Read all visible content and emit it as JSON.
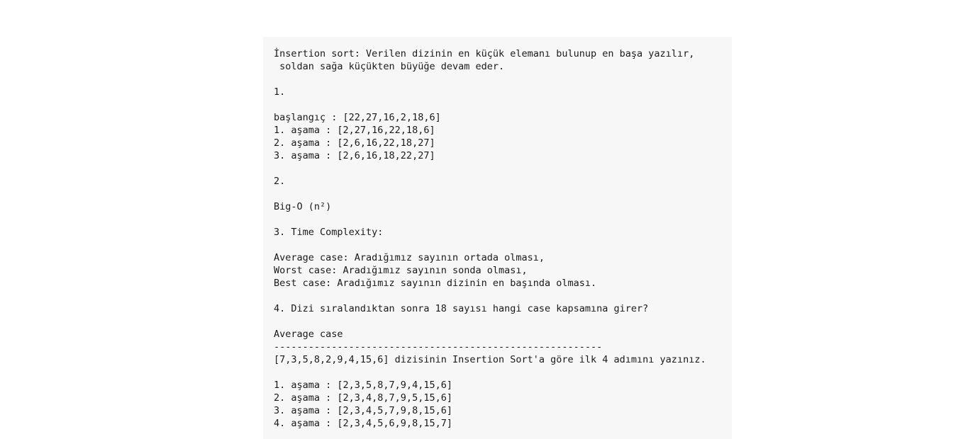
{
  "document": {
    "lines": [
      "İnsertion sort: Verilen dizinin en küçük elemanı bulunup en başa yazılır,",
      " soldan sağa küçükten büyüğe devam eder.",
      "",
      "1.",
      "",
      "başlangıç : [22,27,16,2,18,6]",
      "1. aşama : [2,27,16,22,18,6]",
      "2. aşama : [2,6,16,22,18,27]",
      "3. aşama : [2,6,16,18,22,27]",
      "",
      "2.",
      "",
      "Big-O (n²)",
      "",
      "3. Time Complexity:",
      "",
      "Average case: Aradığımız sayının ortada olması,",
      "Worst case: Aradığımız sayının sonda olması,",
      "Best case: Aradığımız sayının dizinin en başında olması.",
      "",
      "4. Dizi sıralandıktan sonra 18 sayısı hangi case kapsamına girer?",
      "",
      "Average case",
      "---------------------------------------------------------",
      "[7,3,5,8,2,9,4,15,6] dizisinin Insertion Sort'a göre ilk 4 adımını yazınız.",
      "",
      "1. aşama : [2,3,5,8,7,9,4,15,6]",
      "2. aşama : [2,3,4,8,7,9,5,15,6]",
      "3. aşama : [2,3,4,5,7,9,8,15,6]",
      "4. aşama : [2,3,4,5,6,9,8,15,7]"
    ]
  }
}
